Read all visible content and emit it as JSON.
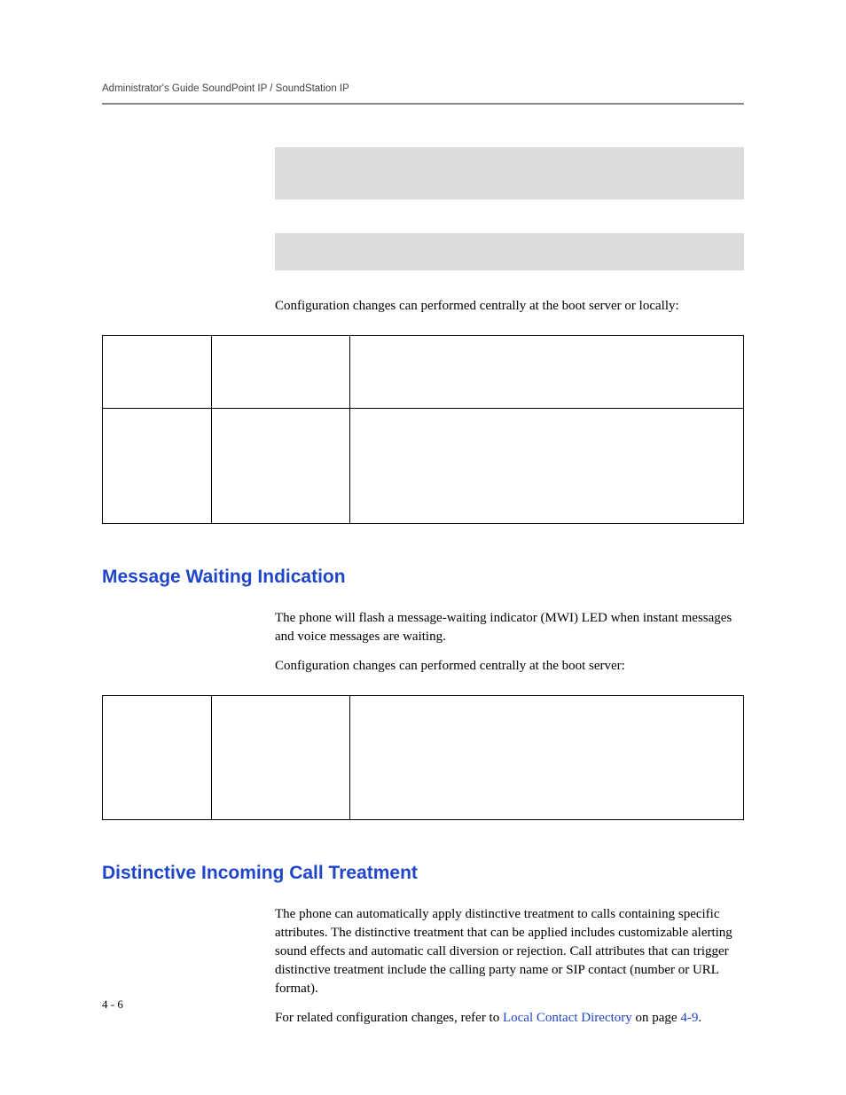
{
  "header": {
    "running": "Administrator's Guide SoundPoint IP / SoundStation IP"
  },
  "intro": {
    "config_note": "Configuration changes can performed centrally at the boot server or locally:"
  },
  "section_mwi": {
    "heading": "Message Waiting Indication",
    "para1": "The phone will flash a message-waiting indicator (MWI) LED when instant messages and voice messages are waiting.",
    "para2": "Configuration changes can performed centrally at the boot server:"
  },
  "section_dict": {
    "heading": "Distinctive Incoming Call Treatment",
    "para1": "The phone can automatically apply distinctive treatment to calls containing specific attributes. The distinctive treatment that can be applied includes customizable alerting sound effects and automatic call diversion or rejection. Call attributes that can trigger distinctive treatment include the calling party name or SIP contact (number or URL format).",
    "para2_pre": "For related configuration changes, refer to ",
    "para2_link": "Local Contact Directory",
    "para2_post": " on page ",
    "para2_page": "4-9",
    "para2_end": "."
  },
  "footer": {
    "page_number": "4 - 6"
  }
}
